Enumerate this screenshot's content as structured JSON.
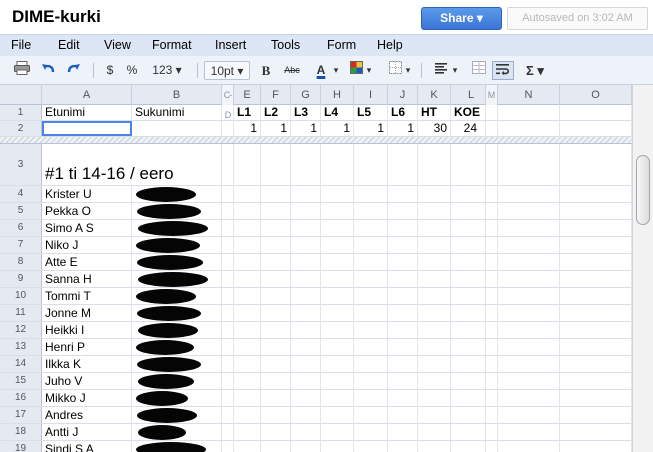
{
  "app": {
    "title": "DIME-kurki",
    "share_label": "Share ▾",
    "autosave_text": "Autosaved on 3:02 AM"
  },
  "menu": [
    "File",
    "Edit",
    "View",
    "Format",
    "Insert",
    "Tools",
    "Form",
    "Help"
  ],
  "toolbar": {
    "currency": "$",
    "percent": "%",
    "number_format": "123 ▾",
    "font_size": "10pt ▾",
    "bold": "B",
    "strike": "Abc",
    "text_color": "A",
    "dropdown": "▾",
    "sum": "Σ ▾"
  },
  "columns": [
    "A",
    "B",
    "C-D",
    "E",
    "F",
    "G",
    "H",
    "I",
    "J",
    "K",
    "L",
    "M",
    "N",
    "O"
  ],
  "header_row": {
    "num": "1",
    "a": "Etunimi",
    "b": "Sukunimi",
    "e": "L1",
    "f": "L2",
    "g": "L3",
    "h": "L4",
    "i": "L5",
    "j": "L6",
    "k": "HT",
    "l": "KOE"
  },
  "row2": {
    "num": "2",
    "e": "1",
    "f": "1",
    "g": "1",
    "h": "1",
    "i": "1",
    "j": "1",
    "k": "30",
    "l": "24"
  },
  "group_row": {
    "num": "3",
    "label": "#1 ti 14-16 / eero"
  },
  "students": [
    {
      "num": "4",
      "name": "Krister U"
    },
    {
      "num": "5",
      "name": "Pekka O"
    },
    {
      "num": "6",
      "name": "Simo A S"
    },
    {
      "num": "7",
      "name": "Niko J"
    },
    {
      "num": "8",
      "name": "Atte E"
    },
    {
      "num": "9",
      "name": "Sanna H"
    },
    {
      "num": "10",
      "name": "Tommi T"
    },
    {
      "num": "11",
      "name": "Jonne M"
    },
    {
      "num": "12",
      "name": "Heikki I"
    },
    {
      "num": "13",
      "name": "Henri P"
    },
    {
      "num": "14",
      "name": "Ilkka K"
    },
    {
      "num": "15",
      "name": "Juho V"
    },
    {
      "num": "16",
      "name": "Mikko J"
    },
    {
      "num": "17",
      "name": "Andres"
    },
    {
      "num": "18",
      "name": "Antti J"
    },
    {
      "num": "19",
      "name": "Sindi S A"
    }
  ]
}
